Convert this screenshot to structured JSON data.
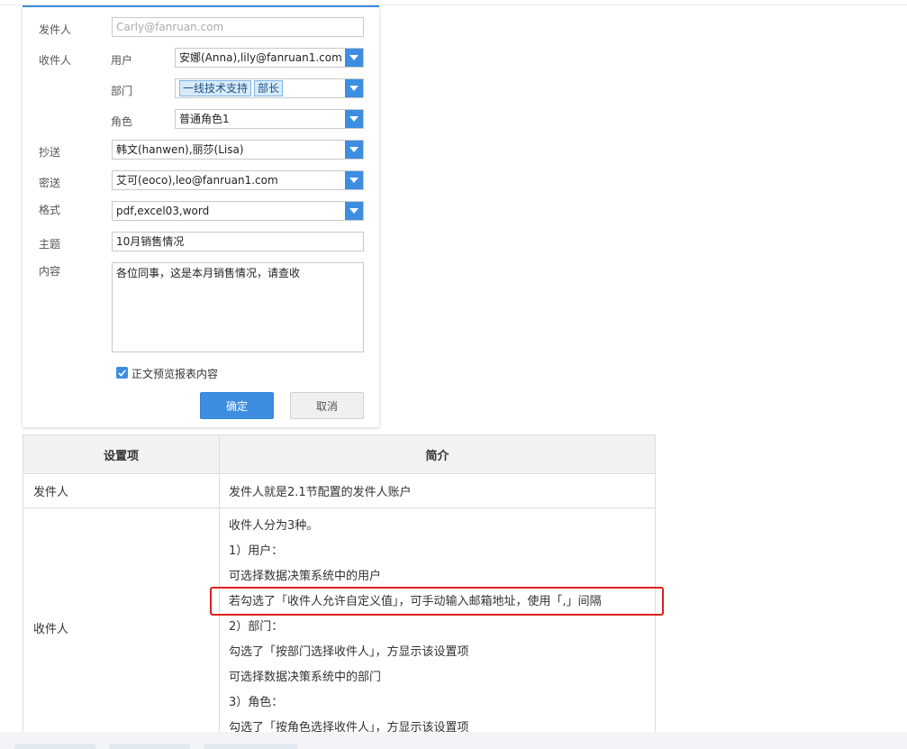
{
  "form": {
    "sender": {
      "label": "发件人",
      "value": "Carly@fanruan.com"
    },
    "recipient": {
      "label": "收件人",
      "user": {
        "label": "用户",
        "value": "安娜(Anna),lily@fanruan1.com"
      },
      "department": {
        "label": "部门",
        "tags": [
          "一线技术支持",
          "部长"
        ]
      },
      "role": {
        "label": "角色",
        "value": "普通角色1"
      }
    },
    "cc": {
      "label": "抄送",
      "value": "韩文(hanwen),丽莎(Lisa)"
    },
    "bcc": {
      "label": "密送",
      "value": "艾可(eoco),leo@fanruan1.com"
    },
    "format": {
      "label": "格式",
      "value": "pdf,excel03,word"
    },
    "subject": {
      "label": "主题",
      "value": "10月销售情况"
    },
    "content": {
      "label": "内容",
      "value": "各位同事，这是本月销售情况，请查收"
    },
    "preview_checkbox": {
      "label": "正文预览报表内容",
      "checked": true
    },
    "ok_label": "确定",
    "cancel_label": "取消"
  },
  "table": {
    "headers": [
      "设置项",
      "简介"
    ],
    "rows": [
      {
        "item": "发件人",
        "lines": [
          "发件人就是2.1节配置的发件人账户"
        ]
      },
      {
        "item": "收件人",
        "lines": [
          "收件人分为3种。",
          "1）用户：",
          "可选择数据决策系统中的用户",
          "若勾选了「收件人允许自定义值」，可手动输入邮箱地址，使用「,」间隔",
          "2）部门：",
          "勾选了「按部门选择收件人」，方显示该设置项",
          "可选择数据决策系统中的部门",
          "3）角色：",
          "勾选了「按角色选择收件人」，方显示该设置项"
        ]
      }
    ]
  },
  "colors": {
    "accent": "#3d8ee0",
    "highlight": "#e02020"
  }
}
